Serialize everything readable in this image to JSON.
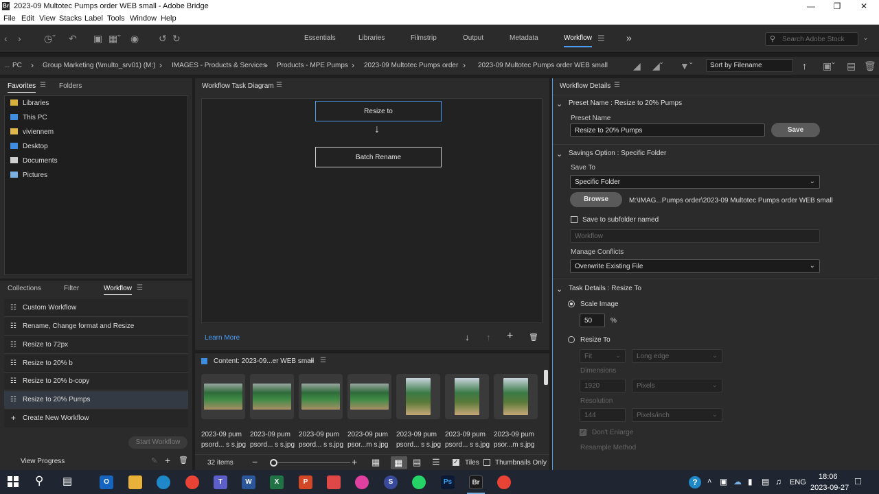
{
  "window": {
    "title": "2023-09 Multotec Pumps order  WEB small - Adobe Bridge",
    "app_icon": "Br"
  },
  "menu": [
    "File",
    "Edit",
    "View",
    "Stacks",
    "Label",
    "Tools",
    "Window",
    "Help"
  ],
  "workspaces": [
    "Essentials",
    "Libraries",
    "Filmstrip",
    "Output",
    "Metadata",
    "Workflow"
  ],
  "search": {
    "placeholder": "Search Adobe Stock"
  },
  "breadcrumbs": [
    "PC",
    "Group Marketing (\\\\multo_srv01) (M:)",
    "IMAGES - Products & Services",
    "Products - MPE Pumps",
    "2023-09 Multotec Pumps order",
    "2023-09 Multotec Pumps order  WEB small"
  ],
  "sort": {
    "label": "Sort by Filename"
  },
  "left_top": {
    "tabs": [
      "Favorites",
      "Folders"
    ],
    "favorites": [
      "Libraries",
      "This PC",
      "viviennem",
      "Desktop",
      "Documents",
      "Pictures"
    ]
  },
  "left_bottom": {
    "tabs": [
      "Collections",
      "Filter",
      "Workflow"
    ],
    "workflows": [
      "Custom Workflow",
      "Rename, Change format and Resize",
      "Resize to 72px",
      "Resize to 20% b",
      "Resize to 20% b-copy",
      "Resize to 20% Pumps"
    ],
    "create_new": "Create New Workflow",
    "start": "Start Workflow",
    "view_progress": "View Progress"
  },
  "diagram": {
    "title": "Workflow Task Diagram",
    "tasks": [
      "Resize to",
      "Batch Rename"
    ],
    "learn_more": "Learn More"
  },
  "content": {
    "title": "Content: 2023-09...er  WEB small",
    "items_count": "32 items",
    "captions": [
      [
        "2023-09 pum",
        "psord... s s.jpg"
      ],
      [
        "2023-09 pum",
        "psord... s s.jpg"
      ],
      [
        "2023-09 pum",
        "psord... s s.jpg"
      ],
      [
        "2023-09 pum",
        "psor...m  s.jpg"
      ],
      [
        "2023-09 pum",
        "psord... s s.jpg"
      ],
      [
        "2023-09 pum",
        "psord... s s.jpg"
      ],
      [
        "2023-09 pum",
        "psor...m  s.jpg"
      ]
    ],
    "tiles_label": "Tiles",
    "thumbnails_only_label": "Thumbnails Only"
  },
  "details": {
    "title": "Workflow Details",
    "preset_section": "Preset Name :  Resize to 20% Pumps",
    "preset_label": "Preset Name",
    "preset_value": "Resize to 20% Pumps",
    "save": "Save",
    "savings_section": "Savings Option :  Specific Folder",
    "save_to_label": "Save To",
    "save_to_value": "Specific Folder",
    "browse": "Browse",
    "path": "M:\\IMAG...Pumps order\\2023-09 Multotec Pumps order  WEB small",
    "subfolder_label": "Save to subfolder named",
    "subfolder_placeholder": "Workflow",
    "conflicts_label": "Manage Conflicts",
    "conflicts_value": "Overwrite Existing File",
    "task_section": "Task Details :  Resize To",
    "scale_image": "Scale Image",
    "scale_value": "50",
    "percent": "%",
    "resize_to": "Resize To",
    "fit": "Fit",
    "long_edge": "Long edge",
    "dimensions_label": "Dimensions",
    "dimensions_value": "1920",
    "pixels": "Pixels",
    "resolution_label": "Resolution",
    "resolution_value": "144",
    "pixels_inch": "Pixels/inch",
    "dont_enlarge": "Don't Enlarge",
    "resample": "Resample Method"
  },
  "taskbar": {
    "lang": "ENG",
    "time": "18:06",
    "date": "2023-09-27"
  },
  "colors": {
    "accent": "#4a9ef5",
    "panel": "#2b2b2b",
    "background": "#1e1e1e"
  }
}
